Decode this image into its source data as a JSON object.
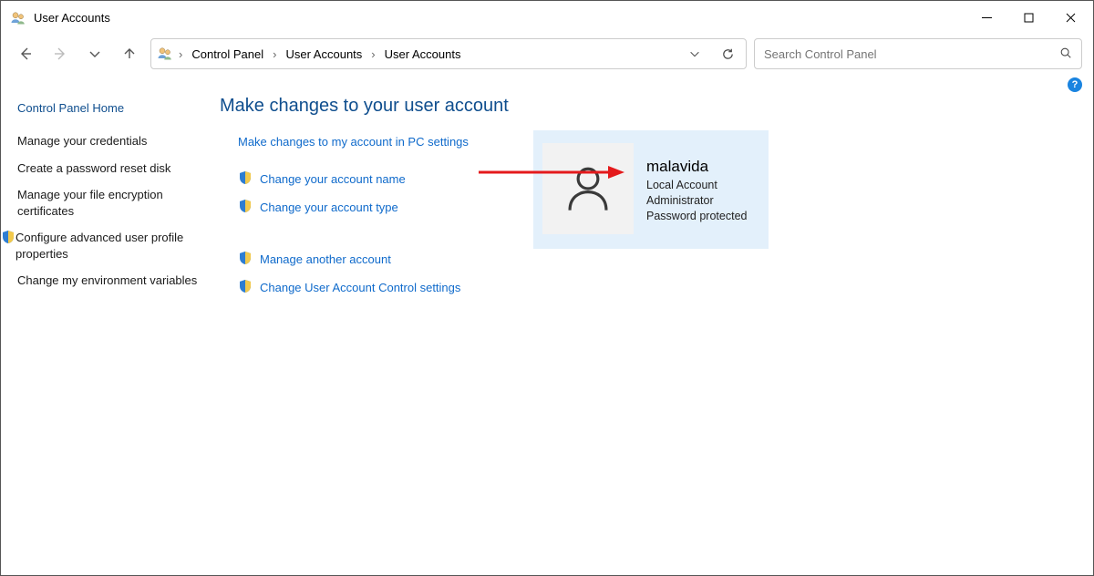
{
  "window": {
    "title": "User Accounts"
  },
  "breadcrumbs": {
    "root": "Control Panel",
    "level1": "User Accounts",
    "level2": "User Accounts"
  },
  "search": {
    "placeholder": "Search Control Panel"
  },
  "sidebar": {
    "header": "Control Panel Home",
    "links": {
      "credentials": "Manage your credentials",
      "reset_disk": "Create a password reset disk",
      "encryption": "Manage your file encryption certificates",
      "advanced_profile": "Configure advanced user profile properties",
      "env_vars": "Change my environment variables"
    }
  },
  "content": {
    "title": "Make changes to your user account",
    "links": {
      "pc_settings": "Make changes to my account in PC settings",
      "change_name": "Change your account name",
      "change_type": "Change your account type",
      "manage_another": "Manage another account",
      "uac": "Change User Account Control settings"
    }
  },
  "account": {
    "name": "malavida",
    "type": "Local Account",
    "role": "Administrator",
    "protection": "Password protected"
  },
  "icons": {
    "shield": "shield-icon",
    "avatar": "person-icon"
  }
}
